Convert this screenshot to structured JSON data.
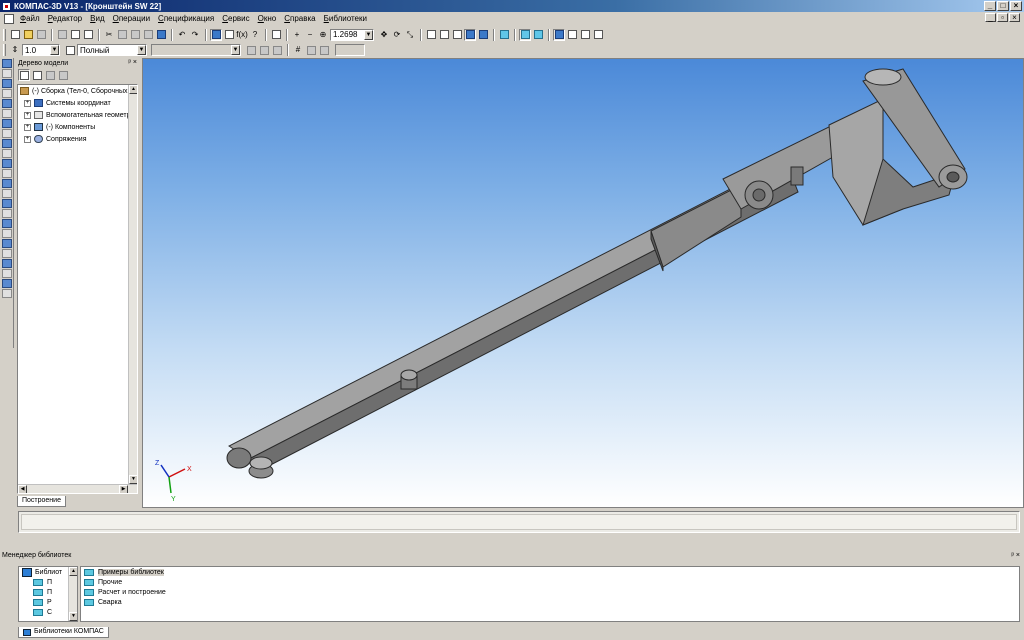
{
  "window": {
    "title": "КОМПАС-3D V13 - [Кронштейн SW 22]"
  },
  "menu": [
    "Файл",
    "Редактор",
    "Вид",
    "Операции",
    "Спецификация",
    "Сервис",
    "Окно",
    "Справка",
    "Библиотеки"
  ],
  "toolbar": {
    "zoom_value": "1.2698",
    "step_value": "1.0",
    "style_value": "Полный"
  },
  "tree_panel": {
    "title": "Дерево модели",
    "items": [
      {
        "label": "(-) Сборка (Тел-0, Сборочных е",
        "icon": "assembly-icon",
        "expander": ""
      },
      {
        "label": "Системы координат",
        "icon": "coordinate-system-icon",
        "expander": "+"
      },
      {
        "label": "Вспомогательная геометри",
        "icon": "aux-geometry-icon",
        "expander": "+"
      },
      {
        "label": "(-) Компоненты",
        "icon": "components-icon",
        "expander": "+"
      },
      {
        "label": "Сопряжения",
        "icon": "mates-icon",
        "expander": "+"
      }
    ],
    "tab": "Построение"
  },
  "triad": {
    "x": "X",
    "y": "Y",
    "z": "Z"
  },
  "library_manager": {
    "title": "Менеджер библиотек",
    "left_root": "Библиот",
    "left_items": [
      "П",
      "П",
      "Р",
      "С"
    ],
    "items": [
      "Примеры библиотек",
      "Прочие",
      "Расчет и построение",
      "Сварка"
    ],
    "bottom_tab": "Библиотеки КОМПАС"
  },
  "colors": {
    "title_start": "#0a246a",
    "viewport_top": "#4b89d8",
    "part_fill": "#8a8a8a"
  }
}
